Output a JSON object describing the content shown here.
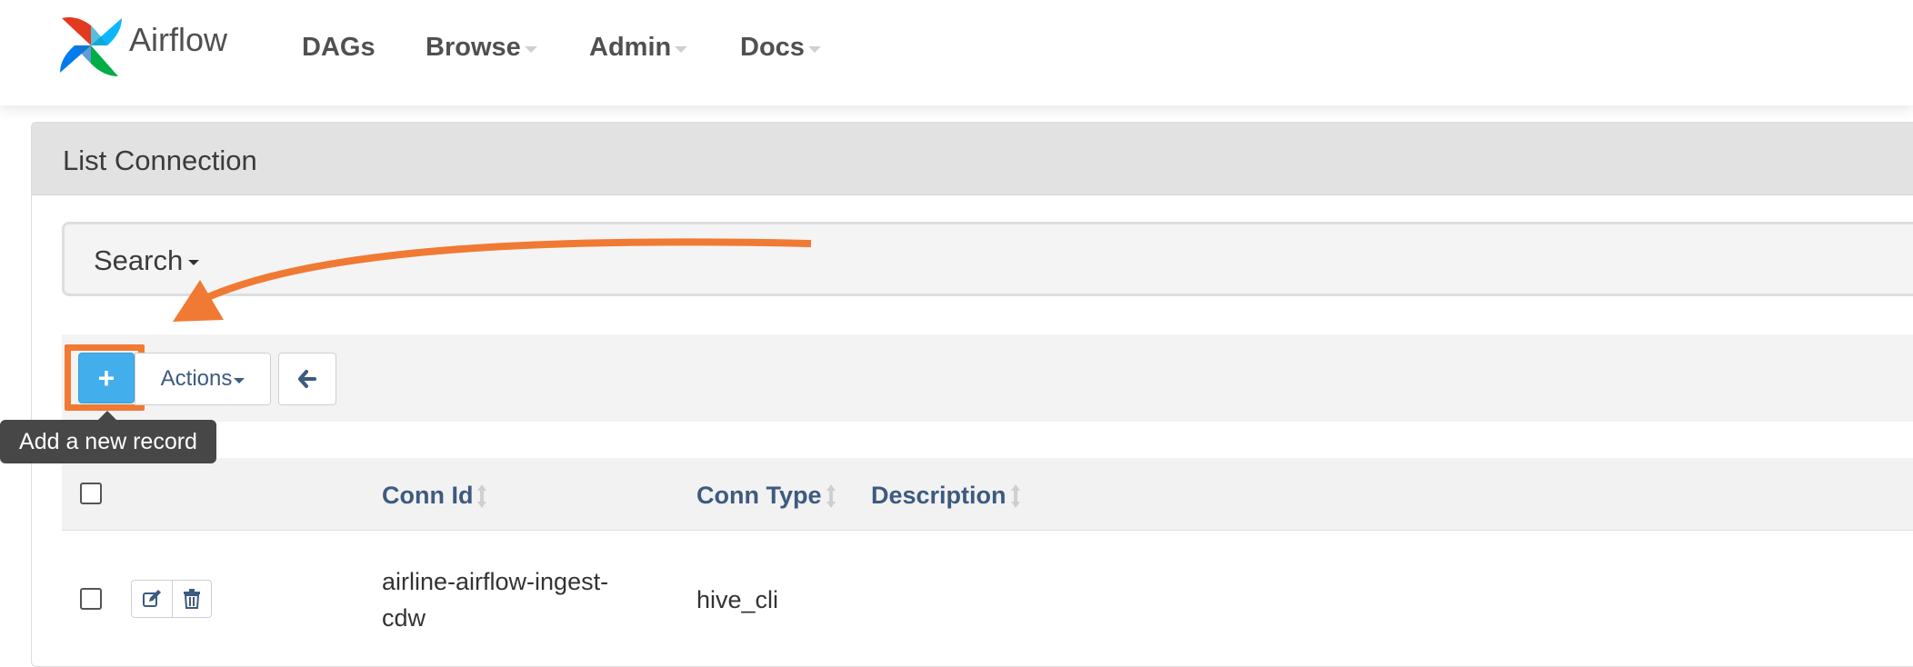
{
  "app": {
    "brand_name": "Airflow",
    "brand_colors": [
      "#e43921",
      "#0cb6ff",
      "#00ad46",
      "#017cee"
    ]
  },
  "nav": {
    "items": [
      {
        "label": "DAGs",
        "dropdown": false
      },
      {
        "label": "Browse",
        "dropdown": true
      },
      {
        "label": "Admin",
        "dropdown": true
      },
      {
        "label": "Docs",
        "dropdown": true
      }
    ]
  },
  "page": {
    "title": "List Connection"
  },
  "search": {
    "label": "Search"
  },
  "toolbar": {
    "add_label": "+",
    "add_tooltip": "Add a new record",
    "actions_label": "Actions",
    "back_icon": "arrow-left-icon"
  },
  "table": {
    "columns": [
      "Conn Id",
      "Conn Type",
      "Description"
    ],
    "rows": [
      {
        "conn_id_line1": "airline-airflow-ingest-",
        "conn_id_line2": "cdw",
        "conn_type": "hive_cli",
        "description": ""
      }
    ]
  },
  "annotation": {
    "color": "#f07a33"
  }
}
